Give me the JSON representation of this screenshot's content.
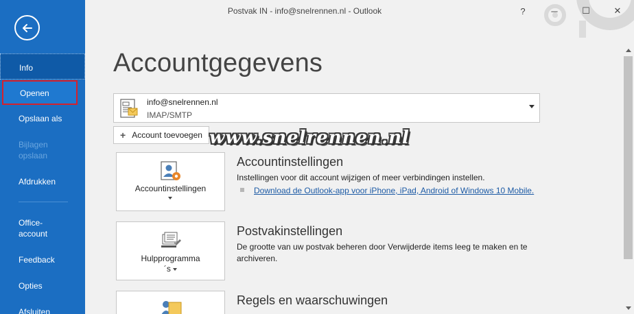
{
  "window": {
    "title": "Postvak IN - info@snelrennen.nl  -  Outlook",
    "help_label": "?",
    "minimize_label": "─",
    "maximize_label": "☐",
    "close_label": "✕"
  },
  "sidebar": {
    "back_icon": "back-arrow-icon",
    "items": [
      {
        "label": "Info",
        "state": "active"
      },
      {
        "label": "Openen",
        "state": "highlighted"
      },
      {
        "label": "Opslaan als",
        "state": "normal"
      },
      {
        "label": "Bijlagen opslaan",
        "state": "disabled"
      },
      {
        "label": "Afdrukken",
        "state": "normal"
      },
      {
        "label": "Office-account",
        "state": "normal"
      },
      {
        "label": "Feedback",
        "state": "normal"
      },
      {
        "label": "Opties",
        "state": "normal"
      },
      {
        "label": "Afsluiten",
        "state": "normal"
      }
    ]
  },
  "main": {
    "page_title": "Accountgegevens",
    "account": {
      "email": "info@snelrennen.nl",
      "type": "IMAP/SMTP"
    },
    "add_account_label": "Account toevoegen",
    "watermark": "www.snelrennen.nl",
    "sections": [
      {
        "tile_label": "Accountinstellingen",
        "title": "Accountinstellingen",
        "description": "Instellingen voor dit account wijzigen of meer verbindingen instellen.",
        "link": "Download de Outlook-app voor iPhone, iPad, Android of Windows 10 Mobile."
      },
      {
        "tile_label_line1": "Hulpprogramma",
        "tile_label_line2": "´s",
        "title": "Postvakinstellingen",
        "description": "De grootte van uw postvak beheren door Verwijderde items leeg te maken en te archiveren."
      },
      {
        "title": "Regels en waarschuwingen"
      }
    ]
  },
  "colors": {
    "sidebar_bg": "#1b6ec2",
    "sidebar_active": "#0f5aa7",
    "highlight_border": "#d8202a",
    "link": "#1c5aa5"
  }
}
